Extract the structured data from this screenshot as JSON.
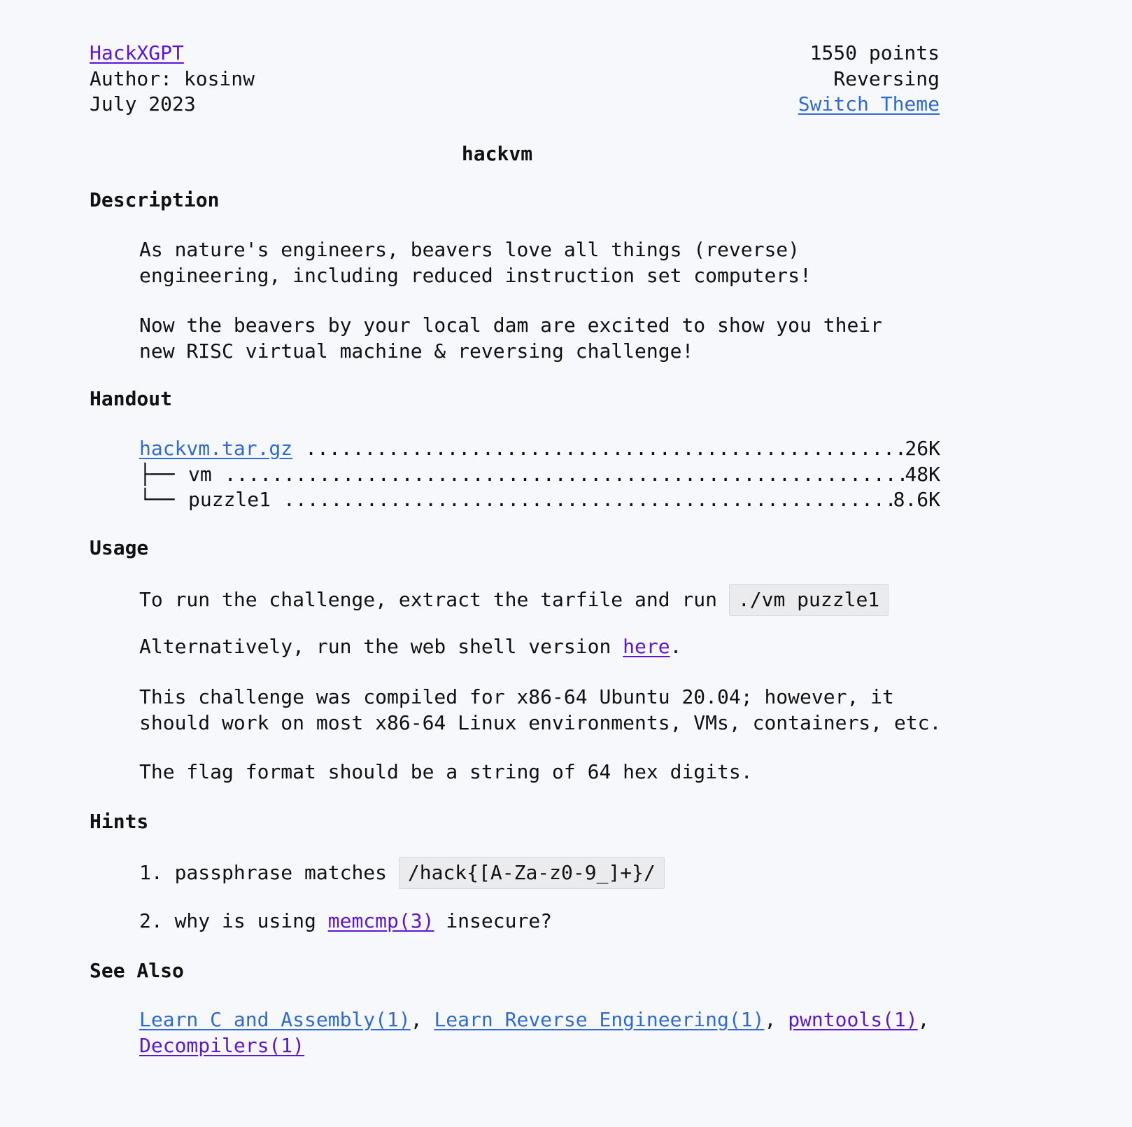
{
  "header": {
    "site_link": "HackXGPT",
    "author": "Author: kosinw",
    "date": "July 2023",
    "points": "1550 points",
    "category": "Reversing",
    "switch_theme": "Switch Theme"
  },
  "challenge": {
    "title": "hackvm"
  },
  "description": {
    "heading": "Description",
    "para1_line1": "As nature's engineers, beavers love all things (reverse)",
    "para1_line2": "engineering, including reduced instruction set computers!",
    "para2_line1": "Now the beavers by your local dam are excited to show you their",
    "para2_line2": "new RISC virtual machine & reversing challenge!"
  },
  "handout": {
    "heading": "Handout",
    "files": [
      {
        "tree": "",
        "name": "hackvm.tar.gz",
        "size": "26K",
        "link": true
      },
      {
        "tree": "├── ",
        "name": "vm",
        "size": "48K",
        "link": false
      },
      {
        "tree": "└── ",
        "name": "puzzle1",
        "size": "8.6K",
        "link": false
      }
    ]
  },
  "usage": {
    "heading": "Usage",
    "run_text": "To run the challenge, extract the tarfile and run",
    "run_code": "./vm puzzle1",
    "alt_text": "Alternatively, run the web shell version",
    "alt_link": "here",
    "alt_end": ".",
    "compiled_line1": "This challenge was compiled for x86-64 Ubuntu 20.04; however, it",
    "compiled_line2": "should work on most x86-64 Linux environments, VMs, containers, etc.",
    "flag_text": "The flag format should be a string of 64 hex digits."
  },
  "hints": {
    "heading": "Hints",
    "hint1_num": "1.",
    "hint1_text": "passphrase matches",
    "hint1_code": "/hack{[A-Za-z0-9_]+}/",
    "hint2_num": "2.",
    "hint2_pre": "why is using",
    "hint2_link": "memcmp(3)",
    "hint2_post": "insecure?"
  },
  "see_also": {
    "heading": "See Also",
    "link1": "Learn C and Assembly(1)",
    "link2": "Learn Reverse Engineering(1)",
    "link3": "pwntools(1)",
    "link4": "Decompilers(1)",
    "sep": ","
  },
  "colors": {
    "background": "#f7f8fb",
    "link_visited": "#5b16d8",
    "link_unvisited": "#2f6bd8",
    "code_background": "#ebebed"
  }
}
